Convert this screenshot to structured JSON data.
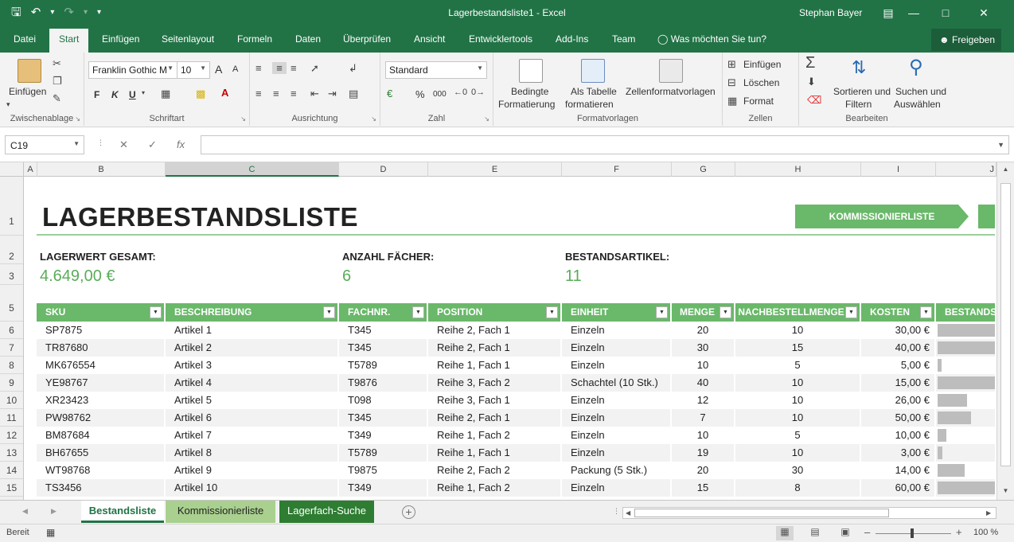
{
  "window": {
    "title": "Lagerbestandsliste1  -  Excel",
    "user": "Stephan Bayer"
  },
  "tabs": [
    "Datei",
    "Start",
    "Einfügen",
    "Seitenlayout",
    "Formeln",
    "Daten",
    "Überprüfen",
    "Ansicht",
    "Entwicklertools",
    "Add-Ins",
    "Team"
  ],
  "active_tab": "Start",
  "tell_me": "Was möchten Sie tun?",
  "share": "Freigeben",
  "ribbon": {
    "clipboard": {
      "paste": "Einfügen",
      "label": "Zwischenablage"
    },
    "font": {
      "name": "Franklin Gothic M",
      "size": "10",
      "bold": "F",
      "italic": "K",
      "underline": "U",
      "grow": "A",
      "shrink": "A",
      "label": "Schriftart"
    },
    "alignment": {
      "label": "Ausrichtung"
    },
    "number": {
      "format": "Standard",
      "percent": "%",
      "thousands": "000",
      "label": "Zahl"
    },
    "styles": {
      "cond1": "Bedingte",
      "cond2": "Formatierung",
      "table1": "Als Tabelle",
      "table2": "formatieren",
      "cell": "Zellenformatvorlagen",
      "label": "Formatvorlagen"
    },
    "cells": {
      "insert": "Einfügen",
      "delete": "Löschen",
      "format": "Format",
      "label": "Zellen"
    },
    "editing": {
      "sort1": "Sortieren und",
      "sort2": "Filtern",
      "find1": "Suchen und",
      "find2": "Auswählen",
      "label": "Bearbeiten"
    }
  },
  "formula_bar": {
    "name_box": "C19",
    "fx": "fx",
    "formula": ""
  },
  "columns": [
    "A",
    "B",
    "C",
    "D",
    "E",
    "F",
    "G",
    "H",
    "I",
    "J"
  ],
  "selected_column": "C",
  "rows": [
    "1",
    "2",
    "3",
    "5",
    "6",
    "7",
    "8",
    "9",
    "10",
    "11",
    "12",
    "13",
    "14",
    "15"
  ],
  "sheet": {
    "title": "LAGERBESTANDSLISTE",
    "nav_button": "KOMMISSIONIERLISTE",
    "kpis": [
      {
        "label": "LAGERWERT GESAMT:",
        "value": "4.649,00 €"
      },
      {
        "label": "ANZAHL FÄCHER:",
        "value": "6"
      },
      {
        "label": "BESTANDSARTIKEL:",
        "value": "11"
      }
    ],
    "headers": [
      "SKU",
      "BESCHREIBUNG",
      "FACHNR.",
      "POSITION",
      "EINHEIT",
      "MENGE",
      "NACHBESTELLMENGE",
      "KOSTEN",
      "BESTANDSW"
    ],
    "items": [
      {
        "sku": "SP7875",
        "desc": "Artikel 1",
        "fach": "T345",
        "pos": "Reihe 2, Fach 1",
        "unit": "Einzeln",
        "qty": "20",
        "reorder": "10",
        "cost": "30,00 €",
        "stock_value_fraction": 1.0
      },
      {
        "sku": "TR87680",
        "desc": "Artikel 2",
        "fach": "T345",
        "pos": "Reihe 2, Fach 1",
        "unit": "Einzeln",
        "qty": "30",
        "reorder": "15",
        "cost": "40,00 €",
        "stock_value_fraction": 1.0
      },
      {
        "sku": "MK676554",
        "desc": "Artikel 3",
        "fach": "T5789",
        "pos": "Reihe 1, Fach 1",
        "unit": "Einzeln",
        "qty": "10",
        "reorder": "5",
        "cost": "5,00 €",
        "stock_value_fraction": 0.07
      },
      {
        "sku": "YE98767",
        "desc": "Artikel 4",
        "fach": "T9876",
        "pos": "Reihe 3, Fach 2",
        "unit": "Schachtel (10 Stk.)",
        "qty": "40",
        "reorder": "10",
        "cost": "15,00 €",
        "stock_value_fraction": 1.0
      },
      {
        "sku": "XR23423",
        "desc": "Artikel 5",
        "fach": "T098",
        "pos": "Reihe 3, Fach 1",
        "unit": "Einzeln",
        "qty": "12",
        "reorder": "10",
        "cost": "26,00 €",
        "stock_value_fraction": 0.5
      },
      {
        "sku": "PW98762",
        "desc": "Artikel 6",
        "fach": "T345",
        "pos": "Reihe 2, Fach 1",
        "unit": "Einzeln",
        "qty": "7",
        "reorder": "10",
        "cost": "50,00 €",
        "stock_value_fraction": 0.57
      },
      {
        "sku": "BM87684",
        "desc": "Artikel 7",
        "fach": "T349",
        "pos": "Reihe 1, Fach 2",
        "unit": "Einzeln",
        "qty": "10",
        "reorder": "5",
        "cost": "10,00 €",
        "stock_value_fraction": 0.15
      },
      {
        "sku": "BH67655",
        "desc": "Artikel 8",
        "fach": "T5789",
        "pos": "Reihe 1, Fach 1",
        "unit": "Einzeln",
        "qty": "19",
        "reorder": "10",
        "cost": "3,00 €",
        "stock_value_fraction": 0.08
      },
      {
        "sku": "WT98768",
        "desc": "Artikel 9",
        "fach": "T9875",
        "pos": "Reihe 2, Fach 2",
        "unit": "Packung (5 Stk.)",
        "qty": "20",
        "reorder": "30",
        "cost": "14,00 €",
        "stock_value_fraction": 0.46
      },
      {
        "sku": "TS3456",
        "desc": "Artikel 10",
        "fach": "T349",
        "pos": "Reihe 1, Fach 2",
        "unit": "Einzeln",
        "qty": "15",
        "reorder": "8",
        "cost": "60,00 €",
        "stock_value_fraction": 1.0
      }
    ]
  },
  "sheet_tabs": [
    "Bestandsliste",
    "Kommissionierliste",
    "Lagerfach-Suche"
  ],
  "status": {
    "ready": "Bereit",
    "zoom": "100 %"
  },
  "colors": {
    "excel_green": "#217346",
    "accent": "#6ab86a",
    "kpi": "#5aac5a"
  }
}
